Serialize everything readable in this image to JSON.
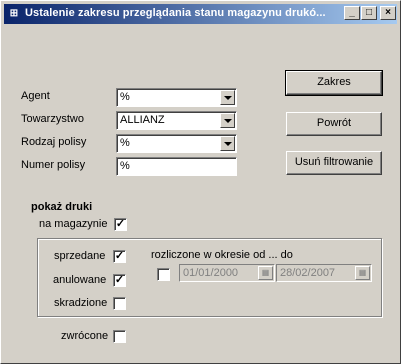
{
  "window": {
    "title": "Ustalenie zakresu przeglądania stanu magazynu drukó...",
    "minimize": "_",
    "maximize": "□",
    "close": "×"
  },
  "form": {
    "agent_label": "Agent",
    "agent_value": "%",
    "towarzystwo_label": "Towarzystwo",
    "towarzystwo_value": "ALLIANZ",
    "rodzaj_label": "Rodzaj polisy",
    "rodzaj_value": "%",
    "numer_label": "Numer polisy",
    "numer_value": "%"
  },
  "buttons": {
    "zakres": "Zakres",
    "powrot": "Powrót",
    "usun": "Usuń filtrowanie"
  },
  "druki": {
    "heading": "pokaż druki",
    "na_magazynie_label": "na magazynie",
    "na_magazynie_checked": true,
    "sprzedane_label": "sprzedane",
    "sprzedane_checked": true,
    "anulowane_label": "anulowane",
    "anulowane_checked": true,
    "skradzione_label": "skradzione",
    "skradzione_checked": false,
    "zwrocone_label": "zwrócone",
    "zwrocone_checked": false,
    "okres_label": "rozliczone w okresie od ... do",
    "okres_checked": false,
    "date_from": "01/01/2000",
    "date_to": "28/02/2007"
  },
  "icons": {
    "check": "✓",
    "calendar": "▦"
  }
}
